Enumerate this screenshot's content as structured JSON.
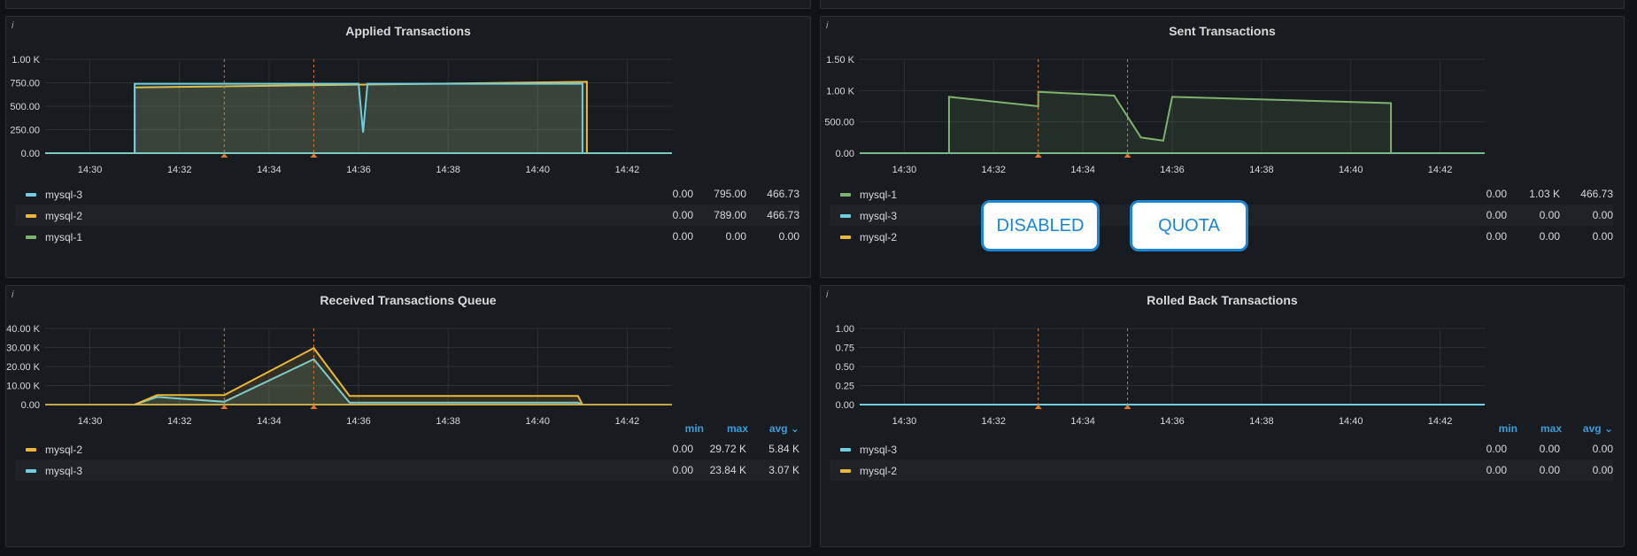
{
  "panels": [
    {
      "title": "Applied Transactions",
      "yticks": [
        "1.00 K",
        "750.00",
        "500.00",
        "250.00",
        "0.00"
      ],
      "xticks": [
        "14:30",
        "14:32",
        "14:34",
        "14:36",
        "14:38",
        "14:40",
        "14:42"
      ],
      "legend_header": null,
      "legend": [
        {
          "name": "mysql-3",
          "color": "#6ccfe2",
          "min": "0.00",
          "max": "795.00",
          "avg": "466.73"
        },
        {
          "name": "mysql-2",
          "color": "#eab839",
          "min": "0.00",
          "max": "789.00",
          "avg": "466.73"
        },
        {
          "name": "mysql-1",
          "color": "#7eb26d",
          "min": "0.00",
          "max": "0.00",
          "avg": "0.00"
        }
      ]
    },
    {
      "title": "Sent Transactions",
      "yticks": [
        "1.50 K",
        "1.00 K",
        "500.00",
        "0.00"
      ],
      "xticks": [
        "14:30",
        "14:32",
        "14:34",
        "14:36",
        "14:38",
        "14:40",
        "14:42"
      ],
      "legend_header": null,
      "legend": [
        {
          "name": "mysql-1",
          "color": "#7eb26d",
          "min": "0.00",
          "max": "1.03 K",
          "avg": "466.73"
        },
        {
          "name": "mysql-3",
          "color": "#6ccfe2",
          "min": "0.00",
          "max": "0.00",
          "avg": "0.00"
        },
        {
          "name": "mysql-2",
          "color": "#eab839",
          "min": "0.00",
          "max": "0.00",
          "avg": "0.00"
        }
      ]
    },
    {
      "title": "Received Transactions Queue",
      "yticks": [
        "40.00 K",
        "30.00 K",
        "20.00 K",
        "10.00 K",
        "0.00"
      ],
      "xticks": [
        "14:30",
        "14:32",
        "14:34",
        "14:36",
        "14:38",
        "14:40",
        "14:42"
      ],
      "legend_header": {
        "min": "min",
        "max": "max",
        "avg": "avg ⌄"
      },
      "legend": [
        {
          "name": "mysql-2",
          "color": "#eab839",
          "min": "0.00",
          "max": "29.72 K",
          "avg": "5.84 K"
        },
        {
          "name": "mysql-3",
          "color": "#6ccfe2",
          "min": "0.00",
          "max": "23.84 K",
          "avg": "3.07 K"
        }
      ]
    },
    {
      "title": "Rolled Back Transactions",
      "yticks": [
        "1.00",
        "0.75",
        "0.50",
        "0.25",
        "0.00"
      ],
      "xticks": [
        "14:30",
        "14:32",
        "14:34",
        "14:36",
        "14:38",
        "14:40",
        "14:42"
      ],
      "legend_header": {
        "min": "min",
        "max": "max",
        "avg": "avg ⌄"
      },
      "legend": [
        {
          "name": "mysql-3",
          "color": "#6ccfe2",
          "min": "0.00",
          "max": "0.00",
          "avg": "0.00"
        },
        {
          "name": "mysql-2",
          "color": "#eab839",
          "min": "0.00",
          "max": "0.00",
          "avg": "0.00"
        }
      ]
    }
  ],
  "callouts": {
    "disabled": "DISABLED",
    "quota": "QUOTA"
  },
  "info_icon": "info-icon",
  "colors": {
    "bg": "#111217",
    "panel": "#181b1f",
    "grid": "#2c3035",
    "annotation": "#e0752d"
  },
  "chart_data": [
    {
      "type": "area",
      "title": "Applied Transactions",
      "xlabel": "",
      "ylabel": "",
      "ylim": [
        0,
        1000
      ],
      "x_range": [
        "14:29",
        "14:43"
      ],
      "annotations_x": [
        "14:33",
        "14:35"
      ],
      "series": [
        {
          "name": "mysql-3",
          "values_x": [
            "14:31",
            "14:31",
            "14:36",
            "14:36.1",
            "14:36.2",
            "14:41",
            "14:41"
          ],
          "values_y": [
            0,
            740,
            740,
            220,
            740,
            740,
            0
          ]
        },
        {
          "name": "mysql-2",
          "values_x": [
            "14:31",
            "14:31",
            "14:41.1",
            "14:41.1"
          ],
          "values_y": [
            0,
            700,
            760,
            0
          ]
        },
        {
          "name": "mysql-1",
          "values_x": [
            "14:29",
            "14:43"
          ],
          "values_y": [
            0,
            0
          ]
        }
      ]
    },
    {
      "type": "area",
      "title": "Sent Transactions",
      "xlabel": "",
      "ylabel": "",
      "ylim": [
        0,
        1500
      ],
      "x_range": [
        "14:29",
        "14:43"
      ],
      "annotations_x": [
        "14:33",
        "14:35"
      ],
      "series": [
        {
          "name": "mysql-1",
          "values_x": [
            "14:31",
            "14:31",
            "14:33",
            "14:33",
            "14:34.7",
            "14:35.3",
            "14:35.8",
            "14:36",
            "14:40.9",
            "14:40.9"
          ],
          "values_y": [
            0,
            900,
            750,
            980,
            920,
            250,
            200,
            900,
            800,
            0
          ]
        },
        {
          "name": "mysql-3",
          "values_x": [
            "14:29",
            "14:43"
          ],
          "values_y": [
            0,
            0
          ]
        },
        {
          "name": "mysql-2",
          "values_x": [
            "14:29",
            "14:43"
          ],
          "values_y": [
            0,
            0
          ]
        }
      ]
    },
    {
      "type": "area",
      "title": "Received Transactions Queue",
      "xlabel": "",
      "ylabel": "",
      "ylim": [
        0,
        40000
      ],
      "x_range": [
        "14:29",
        "14:43"
      ],
      "annotations_x": [
        "14:33",
        "14:35"
      ],
      "series": [
        {
          "name": "mysql-2",
          "values_x": [
            "14:31",
            "14:31.5",
            "14:33",
            "14:35",
            "14:35.8",
            "14:40.9",
            "14:41"
          ],
          "values_y": [
            0,
            5000,
            5000,
            29720,
            4500,
            4500,
            0
          ]
        },
        {
          "name": "mysql-3",
          "values_x": [
            "14:31",
            "14:31.5",
            "14:33",
            "14:35",
            "14:35.8",
            "14:40.9",
            "14:41"
          ],
          "values_y": [
            0,
            4000,
            1500,
            23840,
            1000,
            1000,
            0
          ]
        }
      ]
    },
    {
      "type": "line",
      "title": "Rolled Back Transactions",
      "xlabel": "",
      "ylabel": "",
      "ylim": [
        0,
        1
      ],
      "x_range": [
        "14:29",
        "14:43"
      ],
      "annotations_x": [
        "14:33",
        "14:35"
      ],
      "series": [
        {
          "name": "mysql-3",
          "values_x": [
            "14:29",
            "14:43"
          ],
          "values_y": [
            0,
            0
          ]
        },
        {
          "name": "mysql-2",
          "values_x": [
            "14:29",
            "14:43"
          ],
          "values_y": [
            0,
            0
          ]
        }
      ]
    }
  ]
}
